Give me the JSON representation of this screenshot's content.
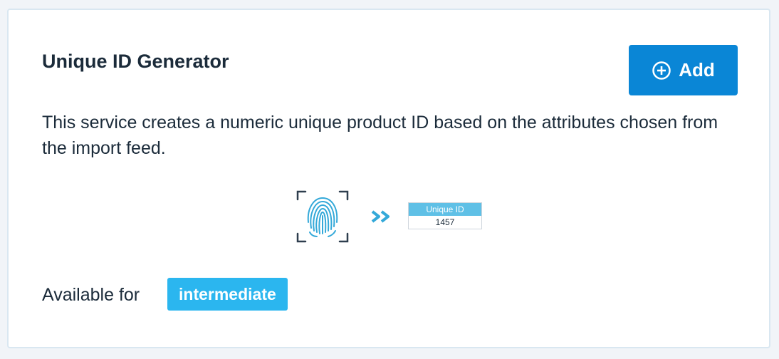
{
  "card": {
    "title": "Unique ID Generator",
    "add_button_label": "Add",
    "description": "This service creates a numeric unique product ID based on the attributes chosen from the import feed.",
    "illustration": {
      "source_icon": "fingerprint-icon",
      "arrow_icon": "double-chevron-right-icon",
      "table_header": "Unique ID",
      "table_value": "1457"
    },
    "availability_label": "Available for",
    "availability_badge": "intermediate"
  },
  "colors": {
    "accent": "#0a86d6",
    "badge": "#2bb6ef",
    "illustration": "#5fc0e6",
    "text": "#1b2b3a"
  }
}
